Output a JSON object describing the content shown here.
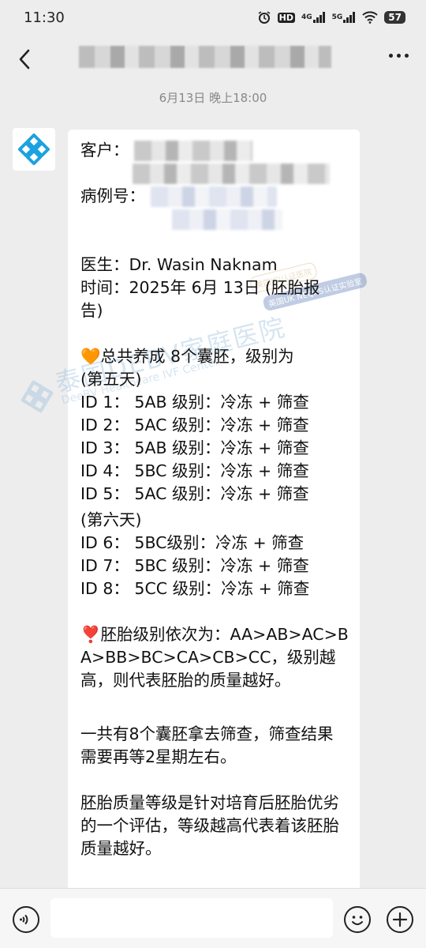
{
  "status_bar": {
    "time": "11:30",
    "icons": [
      "alarm-icon",
      "hd-icon",
      "4g-signal-icon",
      "5g-signal-icon",
      "wifi-icon"
    ],
    "net_4g": "4G",
    "net_5g": "5G",
    "hd_label": "HD",
    "battery": "57"
  },
  "header": {
    "back_icon": "chevron-left-icon",
    "more_icon": "more-dots-icon"
  },
  "chat": {
    "timestamp": "6月13日 晚上18:00",
    "message": {
      "customer_label": "客户：",
      "case_label": "病例号：",
      "doctor": "医生：Dr. Wasin Naknam",
      "time_line1": "时间：2025年 6月 13日 (胚胎报",
      "time_line2": "告)",
      "total_emoji": "🧡",
      "total_line1": "总共养成 8个囊胚，级别为",
      "day5": "(第五天)",
      "ids_day5": [
        "ID 1： 5AB 级别：冷冻 + 筛查",
        "ID 2： 5AC 级别：冷冻 + 筛查",
        "ID 3： 5AB 级别：冷冻 + 筛查",
        "ID 4： 5BC 级别：冷冻 + 筛查",
        "ID 5： 5AC 级别：冷冻 + 筛查"
      ],
      "day6": "(第六天)",
      "ids_day6": [
        "ID 6： 5BC级别：冷冻 + 筛查",
        "ID 7： 5BC 级别：冷冻 + 筛查",
        "ID 8： 5CC 级别：冷冻 + 筛查"
      ],
      "grade_emoji": "❣️",
      "grade_text": "胚胎级别依次为：AA>AB>AC>BA>BB>BC>CA>CB>CC，级别越高，则代表胚胎的质量越好。",
      "screening_text": "一共有8个囊胚拿去筛查，筛查结果需要再等2星期左右。",
      "quality_text": "胚胎质量等级是针对培育后胚胎优劣的一个评估，等级越高代表着该胚胎质量越好。"
    },
    "watermark": {
      "title": "泰国DEBV家庭医院",
      "subtitle": "DeeBV Healthcare IVF Center",
      "badge1": "美国JCI认证医院",
      "badge2": "英国UK NEQAS认证实验室"
    }
  },
  "input_bar": {
    "voice_icon": "voice-icon",
    "emoji_icon": "emoji-icon",
    "plus_icon": "plus-icon",
    "input_value": ""
  },
  "colors": {
    "background": "#ededed",
    "bubble": "#ffffff",
    "avatar_logo": "#1ca2e0",
    "watermark": "#8bb6d9"
  }
}
